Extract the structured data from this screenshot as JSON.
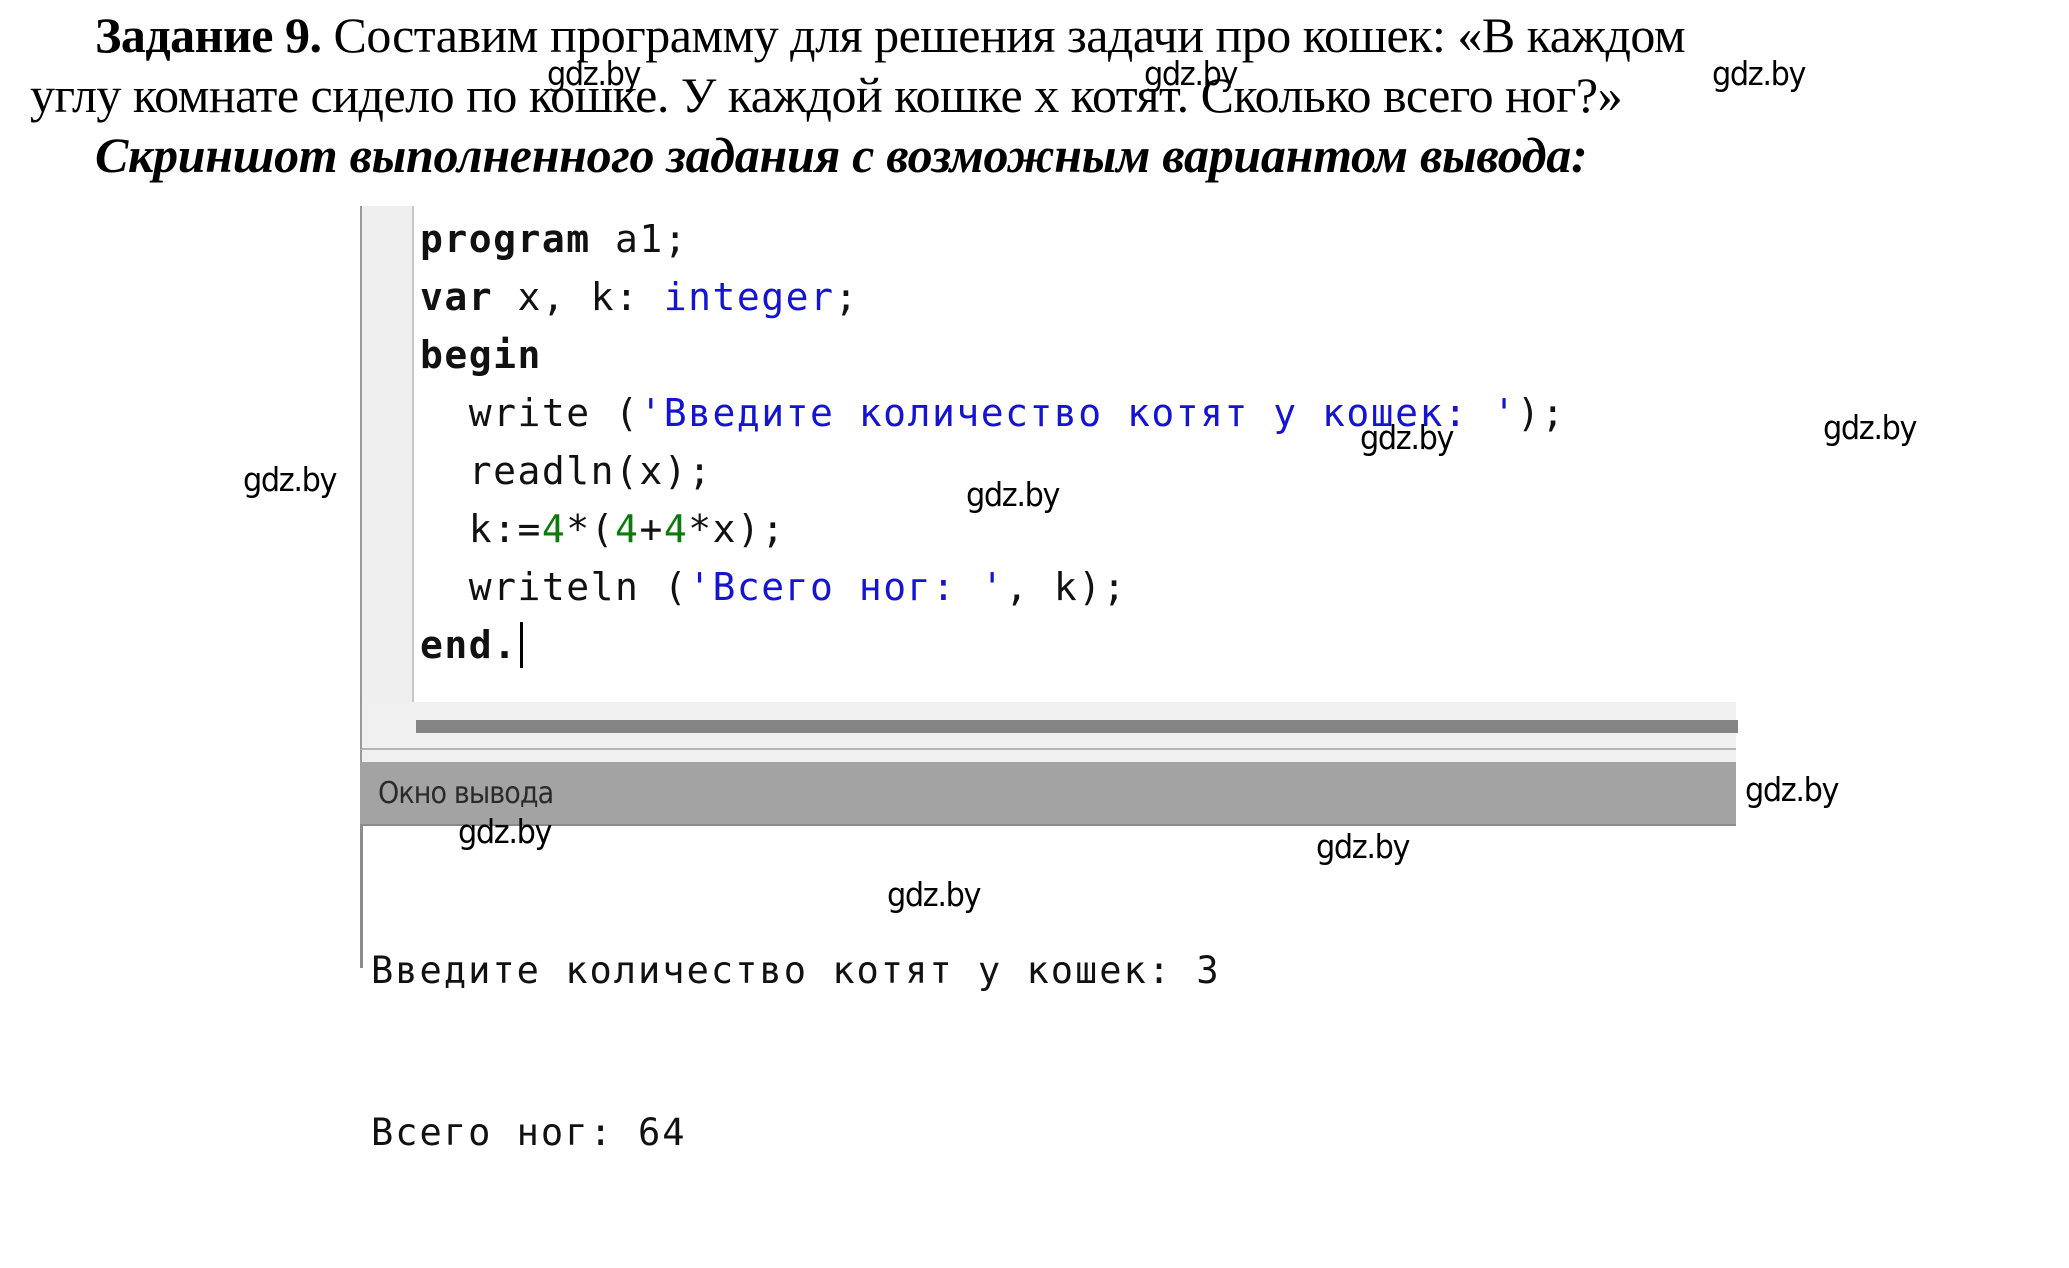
{
  "task": {
    "label": "Задание 9.",
    "text_line1": "Составим программу для решения задачи про кошек: «В каждом",
    "text_line2": "углу комнате сидело по кошке. У каждой кошке x котят. Сколько всего ног?»",
    "caption": "Скриншот выполненного задания с возможным вариантом вывода:"
  },
  "editor": {
    "lines": [
      {
        "tokens": [
          {
            "t": "program",
            "c": "kw"
          },
          {
            "t": " a1;",
            "c": ""
          }
        ]
      },
      {
        "tokens": [
          {
            "t": "var",
            "c": "kw"
          },
          {
            "t": " x, k: ",
            "c": ""
          },
          {
            "t": "integer",
            "c": "ty"
          },
          {
            "t": ";",
            "c": ""
          }
        ]
      },
      {
        "tokens": [
          {
            "t": "begin",
            "c": "kw"
          }
        ]
      },
      {
        "tokens": [
          {
            "t": "  write (",
            "c": ""
          },
          {
            "t": "'Введите количество котят у кошек: '",
            "c": "st"
          },
          {
            "t": ");",
            "c": ""
          }
        ]
      },
      {
        "tokens": [
          {
            "t": "  readln(x);",
            "c": ""
          }
        ]
      },
      {
        "tokens": [
          {
            "t": "  k:=",
            "c": ""
          },
          {
            "t": "4",
            "c": "nu"
          },
          {
            "t": "*(",
            "c": ""
          },
          {
            "t": "4",
            "c": "nu"
          },
          {
            "t": "+",
            "c": ""
          },
          {
            "t": "4",
            "c": "nu"
          },
          {
            "t": "*x);",
            "c": ""
          }
        ]
      },
      {
        "tokens": [
          {
            "t": "  writeln (",
            "c": ""
          },
          {
            "t": "'Всего ног: '",
            "c": "st"
          },
          {
            "t": ", k);",
            "c": ""
          }
        ]
      },
      {
        "tokens": [
          {
            "t": "end.",
            "c": "kw"
          }
        ],
        "caret": true
      }
    ],
    "colors": {
      "keyword": "#111111",
      "type": "#1414d2",
      "string": "#1414d2",
      "number": "#0c7a0c"
    }
  },
  "output": {
    "title": "Окно вывода",
    "lines": [
      "Введите количество котят у кошек: 3",
      "Всего ног: 64"
    ]
  },
  "watermark": "gdz.by"
}
